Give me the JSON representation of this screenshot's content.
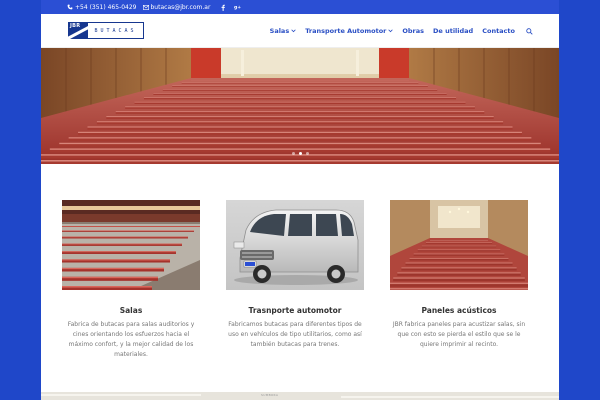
{
  "topbar": {
    "phone": "+54 (351) 465-0429",
    "email": "butacas@jbr.com.ar",
    "social": [
      "facebook-icon",
      "google-plus-icon"
    ]
  },
  "header": {
    "logo_mark": "JBR",
    "logo_word": "BUTACAS",
    "nav": [
      {
        "label": "Salas",
        "dropdown": true
      },
      {
        "label": "Transporte Automotor",
        "dropdown": true
      },
      {
        "label": "Obras",
        "dropdown": false
      },
      {
        "label": "De utilidad",
        "dropdown": false
      },
      {
        "label": "Contacto",
        "dropdown": false
      }
    ]
  },
  "hero": {
    "slides": 3,
    "active_slide": 1
  },
  "cards": [
    {
      "title": "Salas",
      "description": "Fabrica de butacas para salas auditorios y cines orientando los esfuerzos hacia el máximo confort, y la mejor calidad de los materiales."
    },
    {
      "title": "Trasnporte automotor",
      "description": "Fabricamos butacas para diferentes tipos de uso en vehículos de tipo utilitarios, como así también butacas para trenes."
    },
    {
      "title": "Paneles acústicos",
      "description": "JBR fabrica paneles para acustizar salas, sin que con esto se pierda el estilo que se le quiere imprimir al recinto."
    }
  ],
  "map": {
    "label": "SUMBORA"
  },
  "colors": {
    "brand_blue": "#2b4fd4",
    "nav_blue": "#2a4fc4",
    "logo_navy": "#17378f",
    "seat_red": "#c0453c"
  }
}
